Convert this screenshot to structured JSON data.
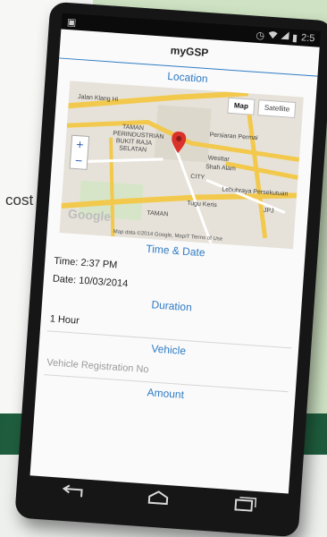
{
  "background": {
    "side_text": "cost"
  },
  "status_bar": {
    "time": "2:5"
  },
  "app": {
    "title": "myGSP"
  },
  "location": {
    "heading": "Location",
    "map": {
      "map_button": "Map",
      "satellite_button": "Satellite",
      "zoom_in": "+",
      "zoom_out": "−",
      "labels": {
        "road_klang": "Jalan Klang Hi",
        "taman": "TAMAN",
        "perindustrian": "PERINDUSTRIAN",
        "bukit_raja": "BUKIT RAJA",
        "selatan": "SELATAN",
        "persiaran": "Persiaran Permai",
        "wetstar": "Westtar",
        "shah_alam": "Shah Alam",
        "lebuhraya": "Lebuhraya Persekutuan",
        "tugu_keris": "Tugu Keris",
        "jpj": "JPJ",
        "taman2": "TAMAN",
        "city": "CITY"
      },
      "logo": "Google",
      "attribution": "Map data ©2014 Google, MapIT   Terms of Use"
    }
  },
  "time_date": {
    "heading": "Time & Date",
    "time_line": "Time: 2:37 PM",
    "date_line": "Date: 10/03/2014"
  },
  "duration": {
    "heading": "Duration",
    "value": "1 Hour"
  },
  "vehicle": {
    "heading": "Vehicle",
    "placeholder": "Vehicle Registration No"
  },
  "amount": {
    "heading": "Amount"
  },
  "colors": {
    "accent": "#2f7bc4",
    "marker": "#d9322b",
    "band": "#2e7a4c"
  },
  "icons": {
    "back": "back-arrow-icon",
    "home": "home-icon",
    "recents": "recent-apps-icon",
    "wifi": "wifi-icon",
    "signal": "signal-icon",
    "battery": "battery-icon",
    "alarm": "alarm-icon",
    "marker": "map-marker-icon"
  }
}
